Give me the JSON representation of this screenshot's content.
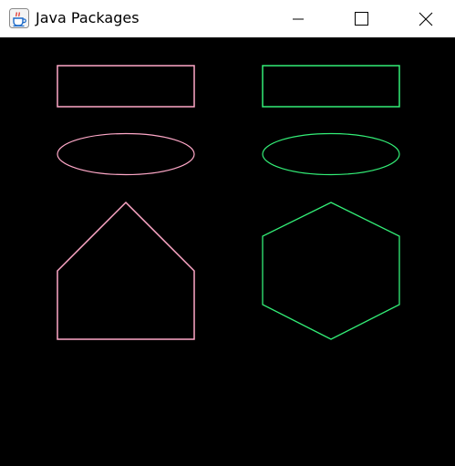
{
  "window": {
    "title": "Java Packages",
    "controls": {
      "minimize_icon": "minimize-icon",
      "maximize_icon": "maximize-icon",
      "close_icon": "close-icon"
    },
    "app_icon": "java-coffee-cup-icon"
  },
  "canvas": {
    "background": "#000000",
    "shape_colors": {
      "left_column": "#ffa8c8",
      "right_column": "#33ee77"
    },
    "shapes": [
      {
        "name": "rectangle",
        "column": "left"
      },
      {
        "name": "rectangle",
        "column": "right"
      },
      {
        "name": "ellipse",
        "column": "left"
      },
      {
        "name": "ellipse",
        "column": "right"
      },
      {
        "name": "pentagon",
        "column": "left"
      },
      {
        "name": "hexagon",
        "column": "right"
      }
    ]
  }
}
